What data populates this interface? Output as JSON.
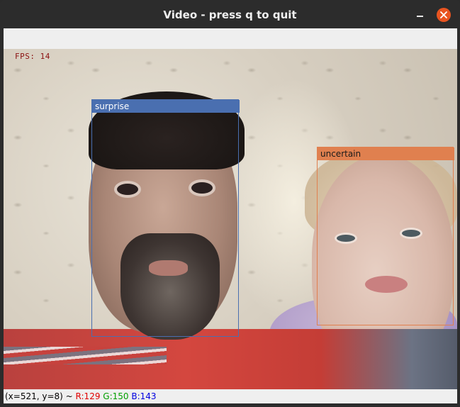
{
  "window": {
    "title": "Video - press q to quit"
  },
  "overlay": {
    "fps_text": "FPS: 14",
    "fps_color": "#8b1010"
  },
  "faces": [
    {
      "label": "surprise",
      "color": "#4a6fb0"
    },
    {
      "label": "uncertain",
      "color": "#e0804f"
    }
  ],
  "status": {
    "coords": "(x=521, y=8) ~",
    "r": "R:129",
    "g": "G:150",
    "b": "B:143",
    "r_color": "#e00000",
    "g_color": "#00a000",
    "b_color": "#0000e0"
  },
  "icons": {
    "minimize": "minimize-icon",
    "close": "close-icon"
  }
}
